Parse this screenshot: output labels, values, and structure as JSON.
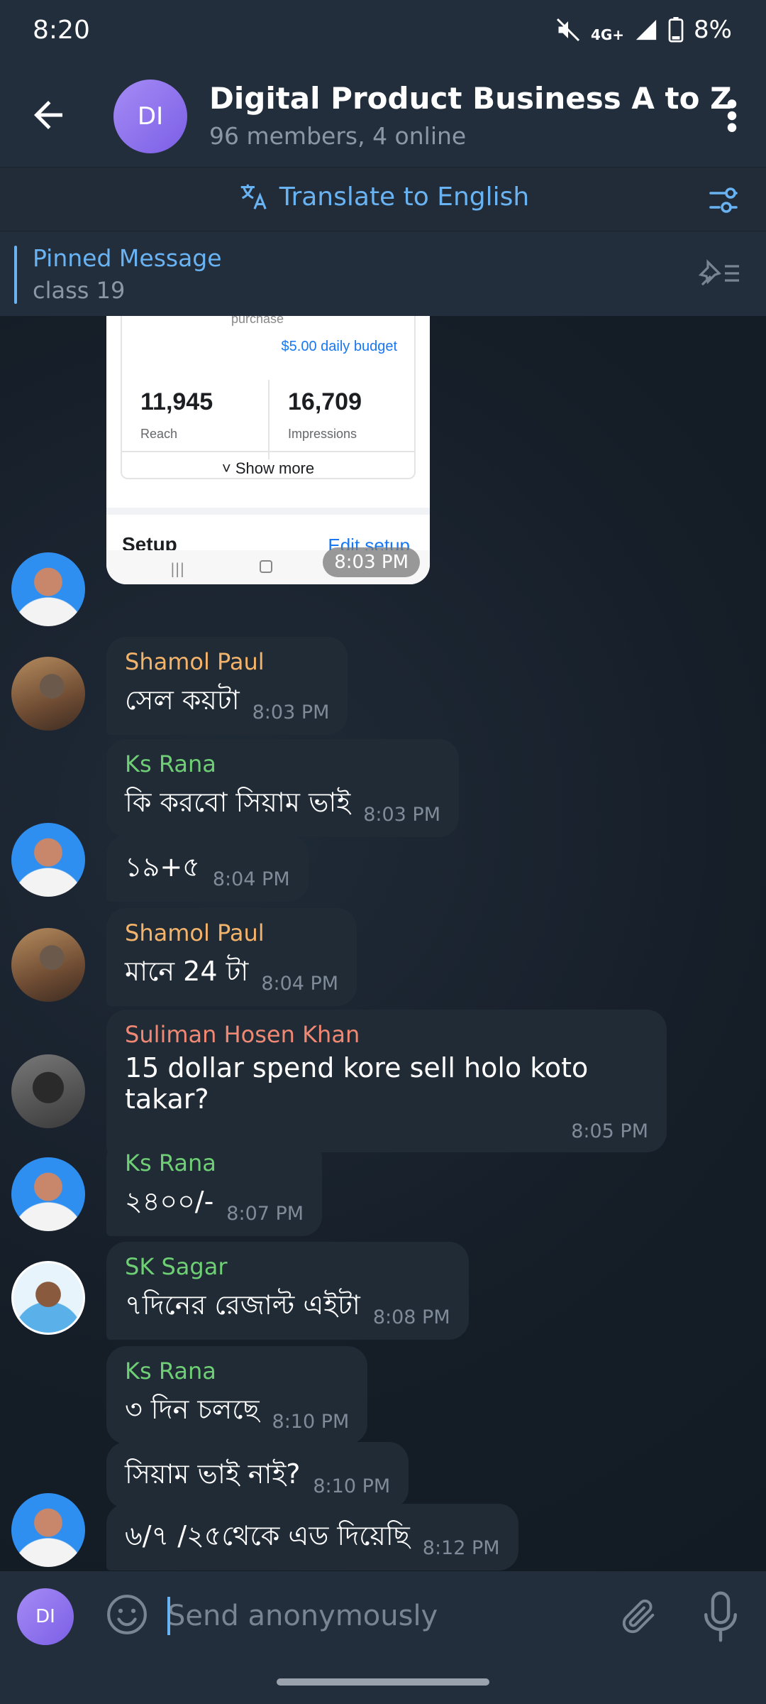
{
  "status": {
    "time": "8:20",
    "network": "4G+",
    "battery": "8%"
  },
  "header": {
    "avatar_initials": "DI",
    "title": "Digital Product Business A to Z",
    "subtitle": "96 members, 4 online"
  },
  "translate": {
    "label": "Translate to English"
  },
  "pinned": {
    "title": "Pinned Message",
    "text": "class 19"
  },
  "photo": {
    "purchase_label": "purchase",
    "budget": "$5.00 daily budget",
    "reach_value": "11,945",
    "reach_label": "Reach",
    "impressions_value": "16,709",
    "impressions_label": "Impressions",
    "show_more": "Show more",
    "setup": "Setup",
    "edit_setup": "Edit setup",
    "time": "8:03 PM"
  },
  "messages": [
    {
      "sender": "Shamol Paul",
      "text": "সেল কয়টা",
      "time": "8:03 PM"
    },
    {
      "sender": "Ks Rana",
      "text": "কি করবো সিয়াম ভাই",
      "time": "8:03 PM"
    },
    {
      "sender": "",
      "text": "১৯+৫",
      "time": "8:04 PM"
    },
    {
      "sender": "Shamol Paul",
      "text": "মানে 24 টা",
      "time": "8:04 PM"
    },
    {
      "sender": "Suliman Hosen Khan",
      "text": "15 dollar spend kore sell holo koto takar?",
      "time": "8:05 PM"
    },
    {
      "sender": "Ks Rana",
      "text": "২৪০০/-",
      "time": "8:07 PM"
    },
    {
      "sender": "SK Sagar",
      "text": "৭দিনের রেজাল্ট এইটা",
      "time": "8:08 PM"
    },
    {
      "sender": "Ks Rana",
      "text": "৩ দিন চলছে",
      "time": "8:10 PM"
    },
    {
      "sender": "",
      "text": "সিয়াম ভাই নাই?",
      "time": "8:10 PM"
    },
    {
      "sender": "",
      "text": "৬/৭ /২৫থেকে এড দিয়েছি",
      "time": "8:12 PM"
    }
  ],
  "composer": {
    "avatar_initials": "DI",
    "placeholder": "Send anonymously"
  },
  "colors": {
    "accent": "#6ab3f3",
    "sender_shamol": "#f4b36a",
    "sender_rana": "#6fcf75",
    "sender_suliman": "#f08873"
  }
}
